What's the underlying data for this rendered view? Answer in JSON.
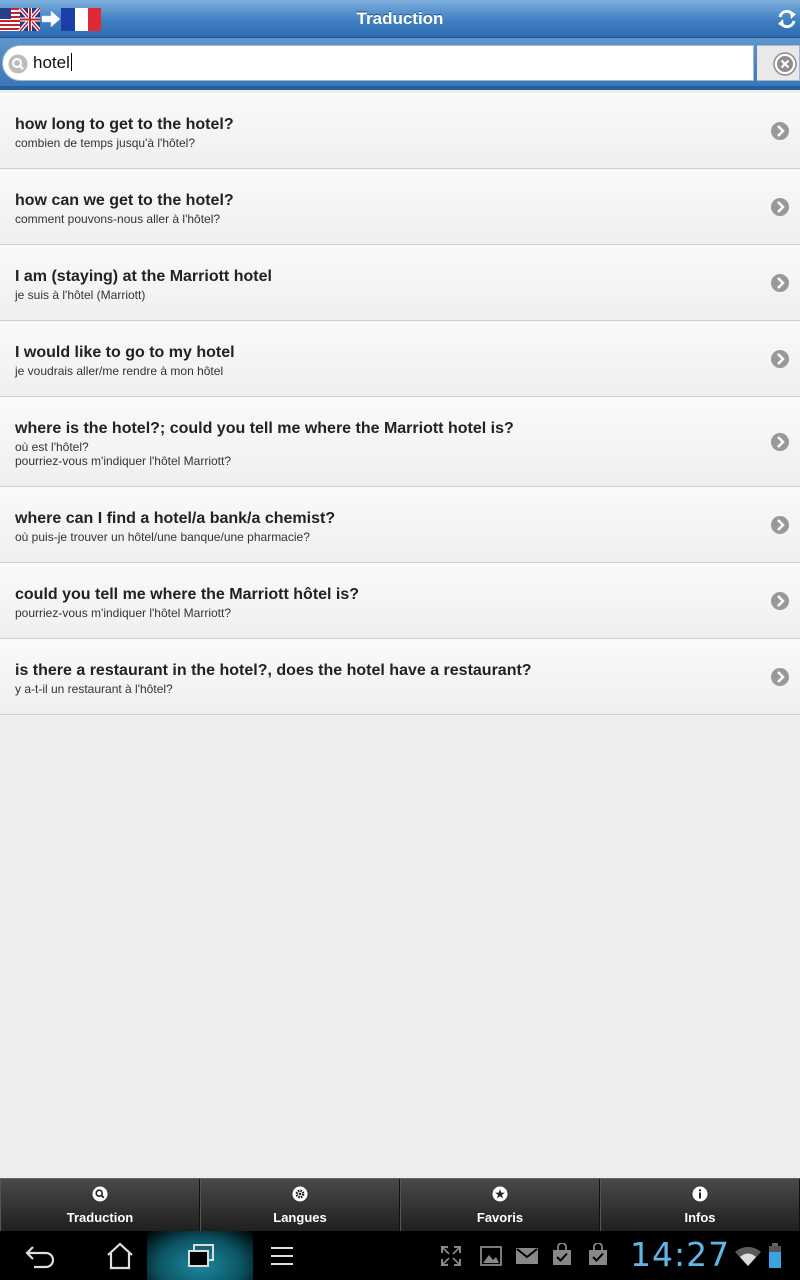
{
  "header": {
    "title": "Traduction"
  },
  "search": {
    "value": "hotel"
  },
  "results": [
    {
      "en": "how long to get to the hotel?",
      "fr": [
        "combien de temps jusqu'à l'hôtel?"
      ]
    },
    {
      "en": "how can we get to the hotel?",
      "fr": [
        "comment pouvons-nous aller à l'hôtel?"
      ]
    },
    {
      "en": "I am (staying) at the Marriott hotel",
      "fr": [
        "je suis à l'hôtel (Marriott)"
      ]
    },
    {
      "en": "I would like to go to my hotel",
      "fr": [
        "je voudrais aller/me rendre à mon hôtel"
      ]
    },
    {
      "en": "where is the hotel?; could you tell me where the Marriott hotel is?",
      "fr": [
        "où est l'hôtel?",
        "pourriez-vous m'indiquer l'hôtel Marriott?"
      ]
    },
    {
      "en": "where can I find a hotel/a bank/a chemist?",
      "fr": [
        "où puis-je trouver un hôtel/une banque/une pharmacie?"
      ]
    },
    {
      "en": "could you tell me where the Marriott hôtel is?",
      "fr": [
        "pourriez-vous m'indiquer l'hôtel Marriott?"
      ]
    },
    {
      "en": "is there a restaurant in the hotel?, does the hotel have a restaurant?",
      "fr": [
        "y a-t-il un restaurant à l'hôtel?"
      ]
    }
  ],
  "tabs": [
    {
      "label": "Traduction",
      "icon": "search-icon"
    },
    {
      "label": "Langues",
      "icon": "gear-icon"
    },
    {
      "label": "Favoris",
      "icon": "star-icon"
    },
    {
      "label": "Infos",
      "icon": "info-icon"
    }
  ],
  "system": {
    "time": "14:27"
  },
  "colors": {
    "header": "#3f7fc2",
    "clock": "#5fb6e8",
    "tabbar": "#2a2a2a"
  }
}
